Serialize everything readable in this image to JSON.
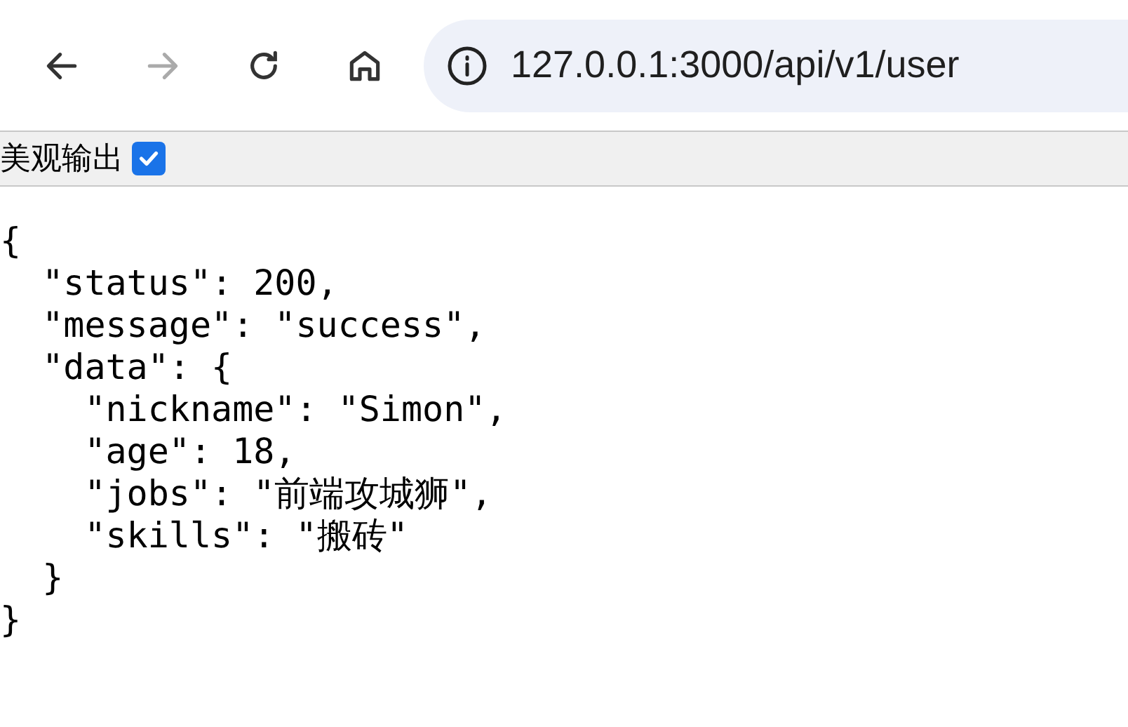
{
  "toolbar": {
    "back_enabled": true,
    "forward_enabled": false,
    "url": "127.0.0.1:3000/api/v1/user"
  },
  "pretty_print": {
    "label": "美观输出",
    "checked": true
  },
  "json_text": "{\n  \"status\": 200,\n  \"message\": \"success\",\n  \"data\": {\n    \"nickname\": \"Simon\",\n    \"age\": 18,\n    \"jobs\": \"前端攻城狮\",\n    \"skills\": \"搬砖\"\n  }\n}"
}
